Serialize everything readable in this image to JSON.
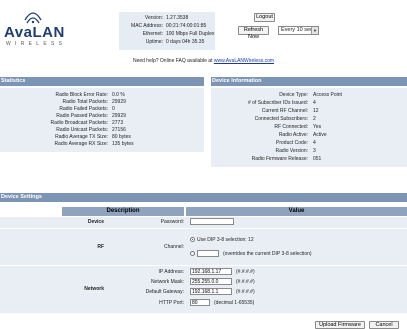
{
  "brand": {
    "name_a": "Ava",
    "name_b": "LAN",
    "tagline": "WIRELESS"
  },
  "header": {
    "info": [
      {
        "label": "Version:",
        "value": "1.27.3538"
      },
      {
        "label": "MAC Address:",
        "value": "00:21:74:00:01:85"
      },
      {
        "label": "Ethernet:",
        "value": "100 Mbps Full Duplex"
      },
      {
        "label": "Uptime:",
        "value": "0 days 04h 35.35"
      }
    ],
    "logout_label": "Logout",
    "refresh_label": "Refresh Now",
    "refresh_interval": "Every 10 sec"
  },
  "help": {
    "text": "Need help?  Online FAQ available at ",
    "link": "www.AvaLANWireless.com"
  },
  "statistics": {
    "title": "Statistics",
    "rows": [
      {
        "label": "Radio Block Error Rate:",
        "value": "0.0 %"
      },
      {
        "label": "Radio Total Packets:",
        "value": "29929"
      },
      {
        "label": "Radio Failed Packets:",
        "value": "0"
      },
      {
        "label": "Radio Passed Packets:",
        "value": "29929"
      },
      {
        "label": "Radio Broadcast Packets:",
        "value": "2773"
      },
      {
        "label": "Radio Unicast Packets:",
        "value": "27156"
      },
      {
        "label": "Radio Average TX Size:",
        "value": "80 bytes"
      },
      {
        "label": "Radio Average RX Size:",
        "value": "135 bytes"
      }
    ]
  },
  "device_info": {
    "title": "Device Information",
    "rows": [
      {
        "label": "Device Type:",
        "value": "Access Point"
      },
      {
        "label": "# of Subscriber IDs Issued:",
        "value": "4"
      },
      {
        "label": "Current RF Channel:",
        "value": "12"
      },
      {
        "label": "Connected Subscribers:",
        "value": "2"
      },
      {
        "label": "RF Connected:",
        "value": "Yes"
      },
      {
        "label": "Radio Active:",
        "value": "Active"
      },
      {
        "label": "Product Code:",
        "value": "4"
      },
      {
        "label": "Radio Version:",
        "value": "3"
      },
      {
        "label": "Radio Firmware Release:",
        "value": "051"
      }
    ]
  },
  "device_settings": {
    "title": "Device Settings",
    "col_description": "Description",
    "col_value": "Value",
    "device": {
      "group": "Device",
      "password_label": "Password:",
      "password_value": ""
    },
    "rf": {
      "group": "RF",
      "channel_label": "Channel:",
      "option_dip": "Use DIP 3-8 selection: 12",
      "option_override": "(overrides the current DIP 3-8 selection)",
      "override_value": ""
    },
    "network": {
      "group": "Network",
      "ip_label": "IP Address:",
      "ip_value": "192.168.1.17",
      "ip_hint": "(#.#.#.#)",
      "mask_label": "Network Mask:",
      "mask_value": "255.255.0.0",
      "mask_hint": "(#.#.#.#)",
      "gateway_label": "Default Gateway:",
      "gateway_value": "192.168.1.1",
      "gateway_hint": "(#.#.#.#)",
      "port_label": "HTTP Port:",
      "port_value": "80",
      "port_hint": "(decimal 1-65535)"
    }
  },
  "footer": {
    "upload_label": "Upload Firmware",
    "cancel_label": "Cancel"
  },
  "colors": {
    "section_header": "#7d95b4",
    "panel_bg": "#e9eef5",
    "brand": "#1c3e72"
  }
}
